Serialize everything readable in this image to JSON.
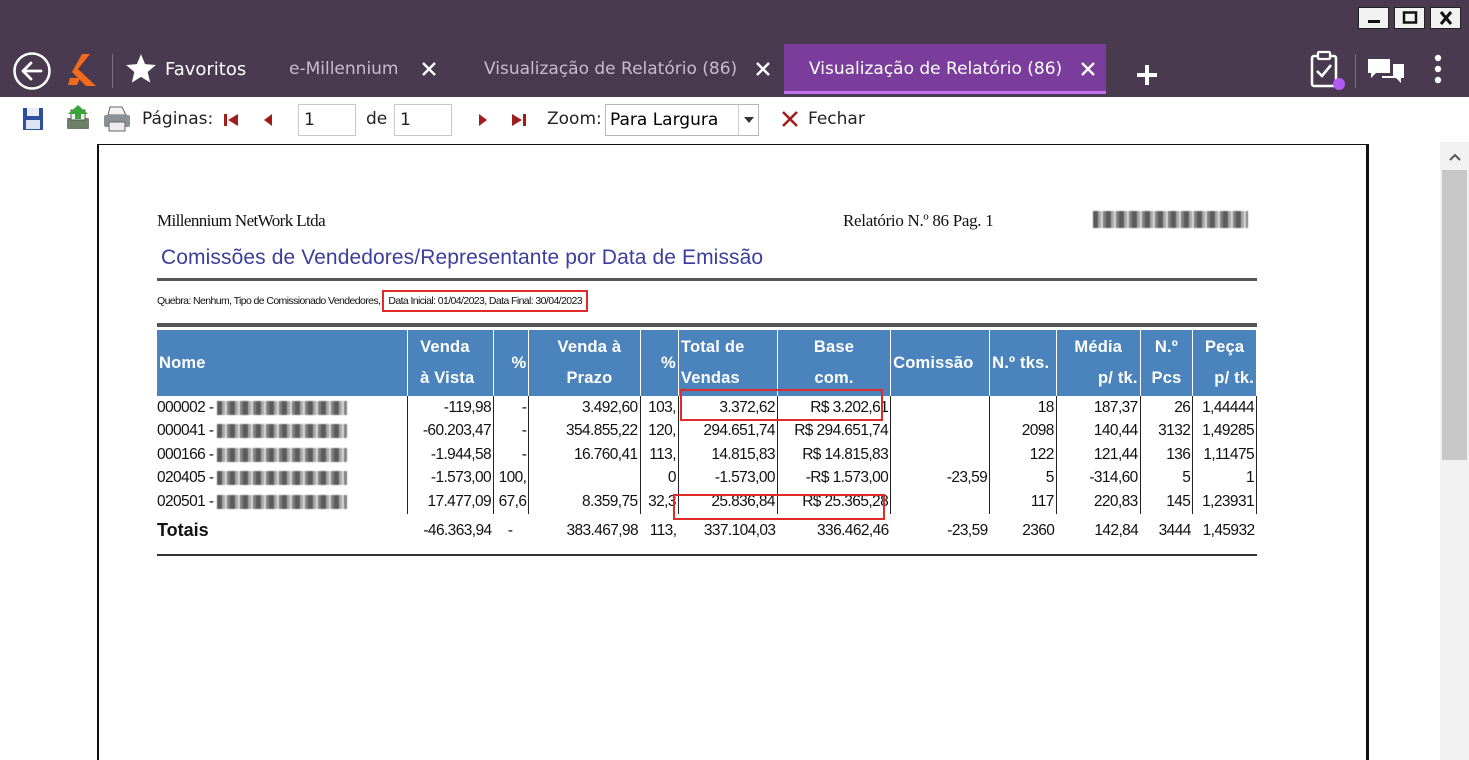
{
  "window": {
    "controls": [
      "minimize-icon",
      "maximize-icon",
      "close-icon"
    ]
  },
  "nav": {
    "favorites_label": "Favoritos"
  },
  "tabs": [
    {
      "label": "e-Millennium",
      "active": false
    },
    {
      "label": "Visualização de Relatório (86)",
      "active": false
    },
    {
      "label": "Visualização de Relatório (86)",
      "active": true
    }
  ],
  "toolbar": {
    "pages_label": "Páginas:",
    "current_page": "1",
    "of_label": "de",
    "total_pages": "1",
    "zoom_label": "Zoom:",
    "zoom_value": "Para Largura",
    "close_label": "Fechar"
  },
  "report": {
    "company": "Millennium NetWork Ltda",
    "report_number": "Relatório N.º 86   Pag. 1",
    "title": "Comissões de Vendedores/Representante por Data de Emissão",
    "params_prefix": "Quebra: Nenhum, Tipo de Comissionado Vendedores,",
    "params_dates": "Data Inicial: 01/04/2023, Data Final: 30/04/2023",
    "columns": [
      [
        "Nome",
        ""
      ],
      [
        "Venda",
        "à Vista"
      ],
      [
        "%",
        ""
      ],
      [
        "Venda à",
        "Prazo"
      ],
      [
        "%",
        ""
      ],
      [
        "Total de",
        "Vendas"
      ],
      [
        "Base",
        "com."
      ],
      [
        "Comissão",
        ""
      ],
      [
        "N.º tks.",
        ""
      ],
      [
        "Média",
        "p/ tk."
      ],
      [
        "N.º",
        "Pcs"
      ],
      [
        "Peça",
        "p/ tk."
      ]
    ],
    "rows": [
      [
        "000002 -",
        "-119,98",
        "-",
        "3.492,60",
        "103,",
        "3.372,62",
        "R$ 3.202,61",
        "",
        "18",
        "187,37",
        "26",
        "1,44444"
      ],
      [
        "000041 -",
        "-60.203,47",
        "-",
        "354.855,22",
        "120,",
        "294.651,74",
        "R$ 294.651,74",
        "",
        "2098",
        "140,44",
        "3132",
        "1,49285"
      ],
      [
        "000166 -",
        "-1.944,58",
        "-",
        "16.760,41",
        "113,",
        "14.815,83",
        "R$ 14.815,83",
        "",
        "122",
        "121,44",
        "136",
        "1,11475"
      ],
      [
        "020405 -",
        "-1.573,00",
        "100,",
        "",
        "0",
        "-1.573,00",
        "-R$ 1.573,00",
        "-23,59",
        "5",
        "-314,60",
        "5",
        "1"
      ],
      [
        "020501 -",
        "17.477,09",
        "67,6",
        "8.359,75",
        "32,3",
        "25.836,84",
        "R$ 25.365,28",
        "",
        "117",
        "220,83",
        "145",
        "1,23931"
      ]
    ],
    "totals": [
      "Totais",
      "-46.363,94",
      "-",
      "383.467,98",
      "113,",
      "337.104,03",
      "336.462,46",
      "-23,59",
      "2360",
      "142,84",
      "3444",
      "1,45932"
    ]
  }
}
